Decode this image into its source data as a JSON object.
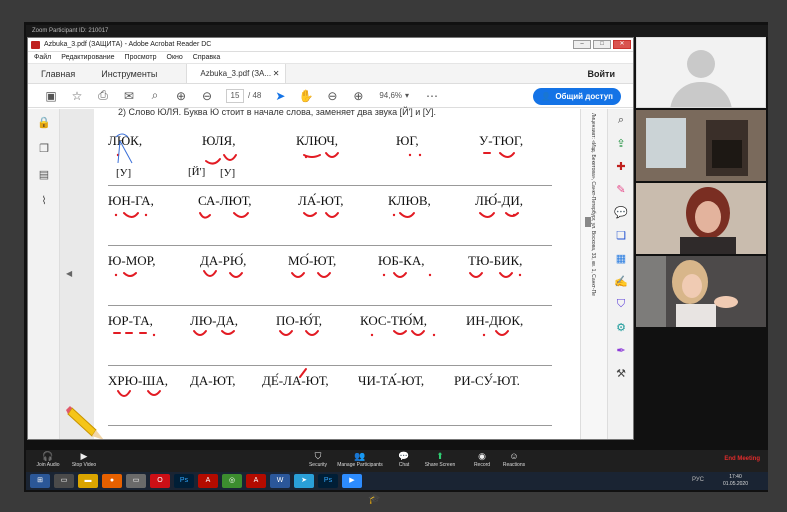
{
  "zoom": {
    "window_title": "Zoom Participant ID: 210017",
    "end_meeting": "End Meeting",
    "controls": [
      {
        "label": "Join Audio",
        "icon": "headphones-icon"
      },
      {
        "label": "Stop Video",
        "icon": "camera-icon"
      },
      {
        "label": "Security",
        "icon": "shield-icon"
      },
      {
        "label": "Manage Participants",
        "icon": "people-icon"
      },
      {
        "label": "Chat",
        "icon": "chat-icon"
      },
      {
        "label": "Share Screen",
        "icon": "share-icon"
      },
      {
        "label": "Record",
        "icon": "record-icon"
      },
      {
        "label": "Reactions",
        "icon": "smile-icon"
      }
    ]
  },
  "acrobat": {
    "title": "Azbuka_3.pdf (ЗАЩИТА) - Adobe Acrobat Reader DC",
    "menu": [
      "Файл",
      "Редактирование",
      "Просмотр",
      "Окно",
      "Справка"
    ],
    "tabs": {
      "home": "Главная",
      "tools": "Инструменты",
      "doc": "Azbuka_3.pdf (ЗА..."
    },
    "signin": "Войти",
    "page_current": "15",
    "page_total": "/ 48",
    "zoom": "94,6%",
    "share": "Общий доступ"
  },
  "document": {
    "header": "2) Слово ЮЛЯ. Буква Ю стоит в начале слова, заменяет два звука [Й'] и [У].",
    "side_text": "Лицензиат: «Изд. Бекетова», Санкт-Петербург, ул. Воскова, 33, кв. 1, Санкт-Пе",
    "rows": [
      [
        "ЛЮК,",
        "ЮЛЯ,",
        "КЛЮЧ,",
        "ЮГ,",
        "У-ТЮГ,"
      ],
      [
        "ЮН-ГА,",
        "СА-ЛЮТ,",
        "ЛА́-ЮТ,",
        "КЛЮВ,",
        "ЛЮ́-ДИ,"
      ],
      [
        "Ю-МОР,",
        "ДА-РЮ́,",
        "МО́-ЮТ,",
        "ЮБ-КА,",
        "ТЮ-БИК,"
      ],
      [
        "ЮР-ТА,",
        "ЛЮ-ДА,",
        "ПО-Ю́Т,",
        "КОС-ТЮ́М,",
        "ИН-ДЮК,"
      ],
      [
        "ХРЮ-ША,",
        "ДА-ЮТ,",
        "ДЕ́-ЛА-ЮТ,",
        "ЧИ-ТА́-ЮТ,",
        "РИ-СУ́-ЮТ."
      ]
    ],
    "phonemes": [
      "[У]",
      "[Й']",
      "[У]"
    ]
  },
  "taskbar": {
    "time": "17:40",
    "date": "01.05.2020",
    "tray": "РУС"
  },
  "colors": {
    "accent": "#1473e6",
    "pdf_red": "#c0201e",
    "ink_red": "#e21b23"
  }
}
